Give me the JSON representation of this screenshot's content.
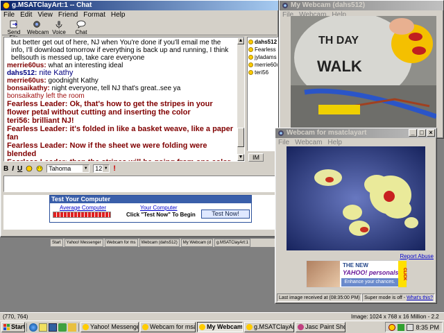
{
  "chat": {
    "title": "g.MSATClayArt:1 -- Chat",
    "menu": [
      "File",
      "Edit",
      "View",
      "Friend",
      "Format",
      "Help"
    ],
    "toolbar": [
      "Send File",
      "Webcam",
      "Voice",
      "Chat"
    ],
    "messages": [
      {
        "name": "",
        "text": "but better get out of here, NJ when You're done if you'll email me the info, I'll download tomorrow if everything is back up and running, I think bellsouth is messed up, take care everyone",
        "style": "plain"
      },
      {
        "name": "merrie60us:",
        "text": " what an interesting ideal",
        "style": "small"
      },
      {
        "name": "dahs512:",
        "text": " nite Kathy",
        "style": "blue"
      },
      {
        "name": "merrie60us:",
        "text": " goodnight Kathy",
        "style": "small"
      },
      {
        "name": "bonsaikathy:",
        "text": " night everyone, tell NJ that's great..see ya",
        "style": "small"
      },
      {
        "name": "bonsaikathy",
        "text": " left the room",
        "style": "red"
      },
      {
        "name": "Fearless Leader:",
        "text": " Ok, that's how to get the stripes in your flower petal without cutting and inserting the color",
        "style": "big"
      },
      {
        "name": "teri56:",
        "text": " brilliant NJ!",
        "style": "big"
      },
      {
        "name": "Fearless Leader:",
        "text": " it's folded in like a basket weave, like a paper fan",
        "style": "big"
      },
      {
        "name": "Fearless Leader:",
        "text": " Now if the sheet we were folding were blended",
        "style": "big"
      },
      {
        "name": "Fearless Leader:",
        "text": " then the stripes will be going from one color to the other",
        "style": "big"
      }
    ],
    "users": [
      "dahs512",
      "Fearless Le",
      "jyladams",
      "merrie60us",
      "teri56"
    ],
    "im_label": "IM",
    "font_name": "Tahoma",
    "font_size": "12",
    "format_buttons": [
      "B",
      "I",
      "U"
    ],
    "ad": {
      "title": "Test Your Computer",
      "avg_label": "Average Computer",
      "your_label": "Your Computer",
      "click_text": "Click \"Test Now\" To Begin",
      "button": "Test Now!"
    },
    "small_tasks": [
      "Start",
      "Yahoo! Messenger",
      "Webcam for ms",
      "Webcam (dahs512)",
      "My Webcam (d",
      "g.MSATClayArt:1"
    ]
  },
  "mywebcam": {
    "title": "My Webcam (dahs512)",
    "menu": [
      "File",
      "Webcam",
      "Help"
    ]
  },
  "webcam2": {
    "title": "Webcam for msatclayart",
    "menu": [
      "File",
      "Webcam",
      "Help"
    ],
    "report": "Report Abuse",
    "ad": {
      "line1": "THE NEW",
      "brand": "YAHOO! personals",
      "line2": "Enhance your chances.",
      "click": "CLICK"
    },
    "status": "Last image received at (08:35:00 PM)",
    "super": "Super mode is off - ",
    "whats": "What's this?"
  },
  "statusbar": {
    "coords": "(770, 764)",
    "image": "Image:  1024 x 768 x 16 Million - 2.2 MBytes"
  },
  "taskbar": {
    "start": "Start",
    "tasks": [
      {
        "label": "Yahoo! Messenge...",
        "pressed": false
      },
      {
        "label": "Webcam for msat...",
        "pressed": false
      },
      {
        "label": "My Webcam (...",
        "pressed": true
      },
      {
        "label": "g.MSATClayArt:1 ...",
        "pressed": false
      },
      {
        "label": "Jasc Paint Shop P...",
        "pressed": false
      }
    ],
    "clock": "8:35 PM"
  },
  "colors": {
    "titlebar": "#0a246a",
    "chat_dark": "#800000",
    "blue_name": "#000080"
  }
}
